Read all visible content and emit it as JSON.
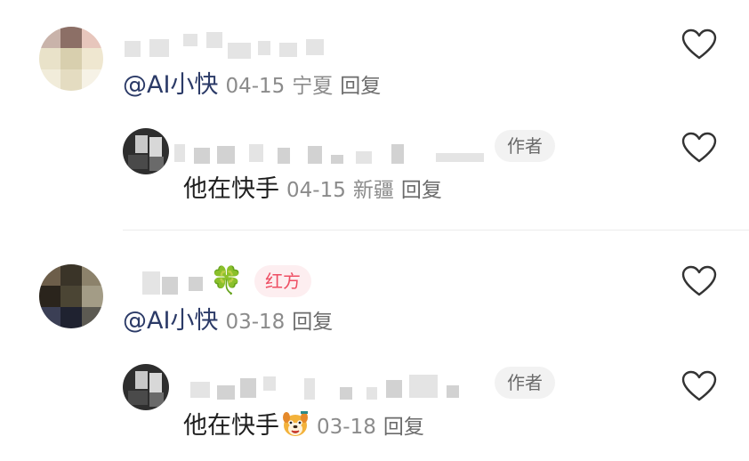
{
  "comments": [
    {
      "mention": "@AI小快",
      "date": "04-15",
      "location": "宁夏",
      "reply_label": "回复",
      "reply": {
        "author_badge": "作者",
        "text": "他在快手",
        "date": "04-15",
        "location": "新疆",
        "reply_label": "回复"
      }
    },
    {
      "badge": "红方",
      "badge_icon": "four-leaf-clover",
      "mention": "@AI小快",
      "date": "03-18",
      "reply_label": "回复",
      "reply": {
        "author_badge": "作者",
        "text": "他在快手",
        "emoji": "dog-face-emoji",
        "date": "03-18",
        "reply_label": "回复"
      }
    }
  ],
  "icons": {
    "like": "heart-outline-icon"
  },
  "colors": {
    "mention": "#2b3a67",
    "meta": "#8b8b8b",
    "badge_red_text": "#ee4e63",
    "badge_red_bg": "#fdeef0",
    "author_badge_bg": "#f2f2f2"
  }
}
